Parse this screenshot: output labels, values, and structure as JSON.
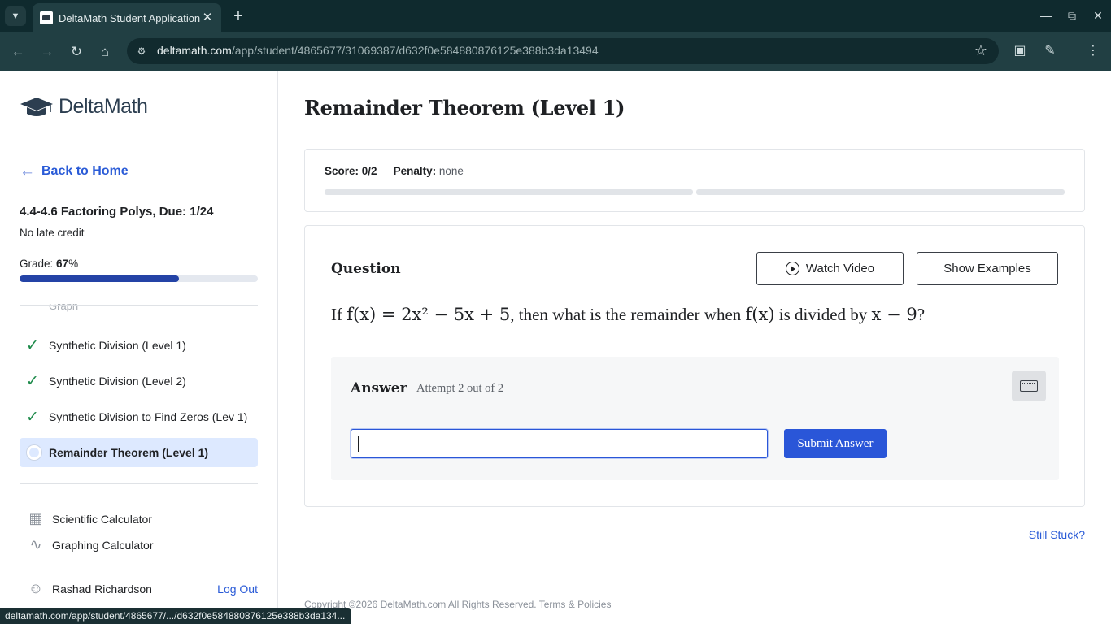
{
  "browser": {
    "tab_title": "DeltaMath Student Application",
    "url_host": "deltamath.com",
    "url_path": "/app/student/4865677/31069387/d632f0e584880876125e388b3da13494",
    "status_url": "deltamath.com/app/student/4865677/.../d632f0e584880876125e388b3da134..."
  },
  "sidebar": {
    "logo_text": "DeltaMath",
    "back_label": "Back to Home",
    "assignment_title": "4.4-4.6 Factoring Polys, Due: 1/24",
    "late_credit": "No late credit",
    "grade_label": "Grade: ",
    "grade_value": "67",
    "grade_suffix": "%",
    "grade_fraction": 0.67,
    "cut_item": "Graph",
    "skills": [
      {
        "label": "Synthetic Division (Level 1)",
        "done": true
      },
      {
        "label": "Synthetic Division (Level 2)",
        "done": true
      },
      {
        "label": "Synthetic Division to Find Zeros (Lev 1)",
        "done": true
      },
      {
        "label": "Remainder Theorem (Level 1)",
        "done": false,
        "active": true
      }
    ],
    "tools": {
      "scientific": "Scientific Calculator",
      "graphing": "Graphing Calculator"
    },
    "user_name": "Rashad Richardson",
    "logout": "Log Out"
  },
  "main": {
    "title": "Remainder Theorem (Level 1)",
    "score_label": "Score:",
    "score_value": "0/2",
    "penalty_label": "Penalty:",
    "penalty_value": "none",
    "question_label": "Question",
    "watch_video": "Watch Video",
    "show_examples": "Show Examples",
    "question": {
      "p1": "If ",
      "m1": "f(x) = 2x² − 5x + 5",
      "p2": ", then what is the remainder when ",
      "m2": "f(x)",
      "p3": " is divided by ",
      "m3": "x − 9",
      "p4": "?"
    },
    "answer_label": "Answer",
    "attempt_text": "Attempt 2 out of 2",
    "answer_value": "",
    "submit": "Submit Answer",
    "still_stuck": "Still Stuck?",
    "footer": "Copyright ©2026 DeltaMath.com All Rights Reserved. Terms & Policies"
  }
}
